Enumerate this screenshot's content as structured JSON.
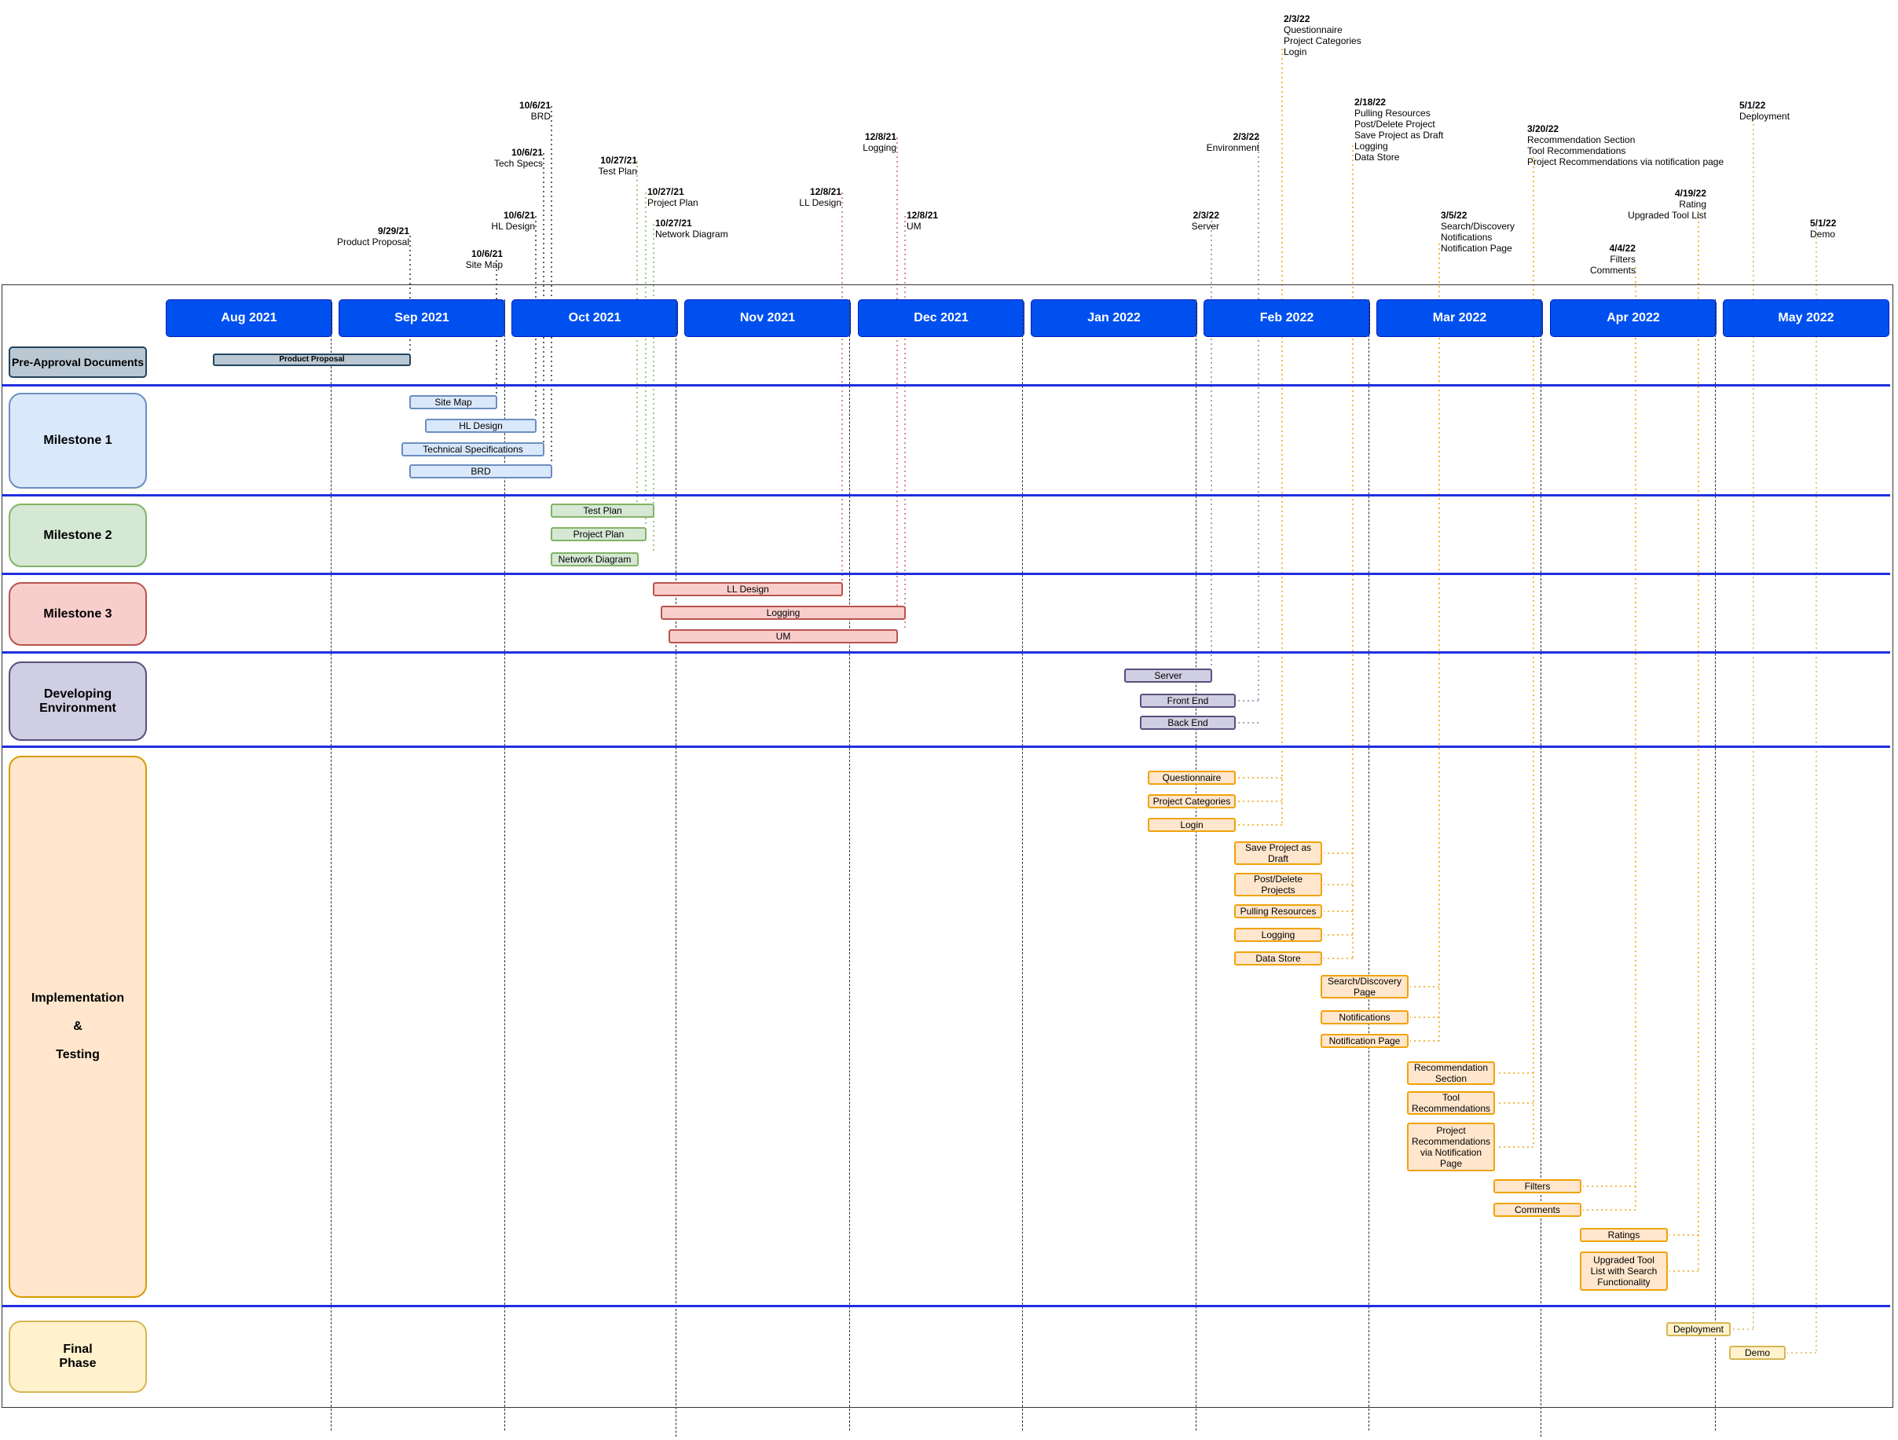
{
  "months": [
    "Aug 2021",
    "Sep 2021",
    "Oct 2021",
    "Nov 2021",
    "Dec 2021",
    "Jan 2022",
    "Feb 2022",
    "Mar 2022",
    "Apr 2022",
    "May 2022"
  ],
  "phases": {
    "pre_approval": "Pre-Approval Documents",
    "milestone1": "Milestone 1",
    "milestone2": "Milestone 2",
    "milestone3": "Milestone 3",
    "developing": "Developing\nEnvironment",
    "implementation": "Implementation\n\n&\n\nTesting",
    "final": "Final\nPhase"
  },
  "tasks": {
    "product_proposal": "Product Proposal",
    "site_map": "Site Map",
    "hl_design": "HL Design",
    "technical_specifications": "Technical Specifications",
    "brd": "BRD",
    "test_plan": "Test Plan",
    "project_plan": "Project Plan",
    "network_diagram": "Network Diagram",
    "ll_design": "LL Design",
    "logging_m3": "Logging",
    "um": "UM",
    "server": "Server",
    "front_end": "Front End",
    "back_end": "Back End",
    "questionnaire": "Questionnaire",
    "project_categories": "Project Categories",
    "login": "Login",
    "save_project_draft": "Save Project as\nDraft",
    "post_delete_projects": "Post/Delete\nProjects",
    "pulling_resources": "Pulling Resources",
    "logging_impl": "Logging",
    "data_store": "Data Store",
    "search_discovery_page": "Search/Discovery\nPage",
    "notifications": "Notifications",
    "notification_page": "Notification Page",
    "recommendation_section": "Recommendation\nSection",
    "tool_recommendations": "Tool\nRecommendations",
    "project_recommendations": "Project\nRecommendations\nvia Notification\nPage",
    "filters": "Filters",
    "comments": "Comments",
    "ratings": "Ratings",
    "upgraded_tool_list": "Upgraded Tool\nList with Search\nFunctionality",
    "deployment": "Deployment",
    "demo": "Demo"
  },
  "annotations": {
    "a_0929": {
      "date": "9/29/21",
      "text": "Product Proposal"
    },
    "a_1006_sm": {
      "date": "10/6/21",
      "text": "Site Map"
    },
    "a_1006_hl": {
      "date": "10/6/21",
      "text": "HL Design"
    },
    "a_1006_ts": {
      "date": "10/6/21",
      "text": "Tech Specs"
    },
    "a_1006_brd": {
      "date": "10/6/21",
      "text": "BRD"
    },
    "a_1027_tp": {
      "date": "10/27/21",
      "text": "Test Plan"
    },
    "a_1027_pp": {
      "date": "10/27/21",
      "text": "Project Plan"
    },
    "a_1027_nd": {
      "date": "10/27/21",
      "text": "Network Diagram"
    },
    "a_1208_ll": {
      "date": "12/8/21",
      "text": "LL Design"
    },
    "a_1208_log": {
      "date": "12/8/21",
      "text": "Logging"
    },
    "a_1208_um": {
      "date": "12/8/21",
      "text": "UM"
    },
    "a_0203_srv": {
      "date": "2/3/22",
      "text": "Server"
    },
    "a_0203_env": {
      "date": "2/3/22",
      "text": "Environment"
    },
    "a_0203_q": {
      "date": "2/3/22",
      "text": "Questionnaire\nProject Categories\nLogin"
    },
    "a_0218": {
      "date": "2/18/22",
      "text": "Pulling Resources\nPost/Delete Project\nSave Project as Draft\nLogging\nData Store"
    },
    "a_0305": {
      "date": "3/5/22",
      "text": "Search/Discovery\nNotifications\nNotification Page"
    },
    "a_0320": {
      "date": "3/20/22",
      "text": "Recommendation Section\nTool Recommendations\nProject Recommendations via notification page"
    },
    "a_0404": {
      "date": "4/4/22",
      "text": "Filters\nComments"
    },
    "a_0419": {
      "date": "4/19/22",
      "text": "Rating\nUpgraded Tool List"
    },
    "a_0501_dep": {
      "date": "5/1/22",
      "text": "Deployment"
    },
    "a_0501_demo": {
      "date": "5/1/22",
      "text": "Demo"
    }
  },
  "colors": {
    "month_fill": "#0050ef",
    "separator": "#1f2fe0",
    "pre_approval_fill": "#bac8d3",
    "pre_approval_stroke": "#23445d",
    "milestone1_fill": "#dae8fc",
    "milestone1_stroke": "#6c8ebf",
    "milestone2_fill": "#d5e8d4",
    "milestone2_stroke": "#82b366",
    "milestone3_fill": "#f8cecc",
    "milestone3_stroke": "#b85450",
    "developing_fill": "#d0cee2",
    "developing_stroke": "#56517e",
    "implementation_fill": "#ffe6cc",
    "implementation_stroke": "#d79b00",
    "final_fill": "#fff2cc",
    "final_stroke": "#d6b656",
    "implementation_task_fill": "#ffe6cc",
    "implementation_task_stroke": "#f0a30a"
  }
}
